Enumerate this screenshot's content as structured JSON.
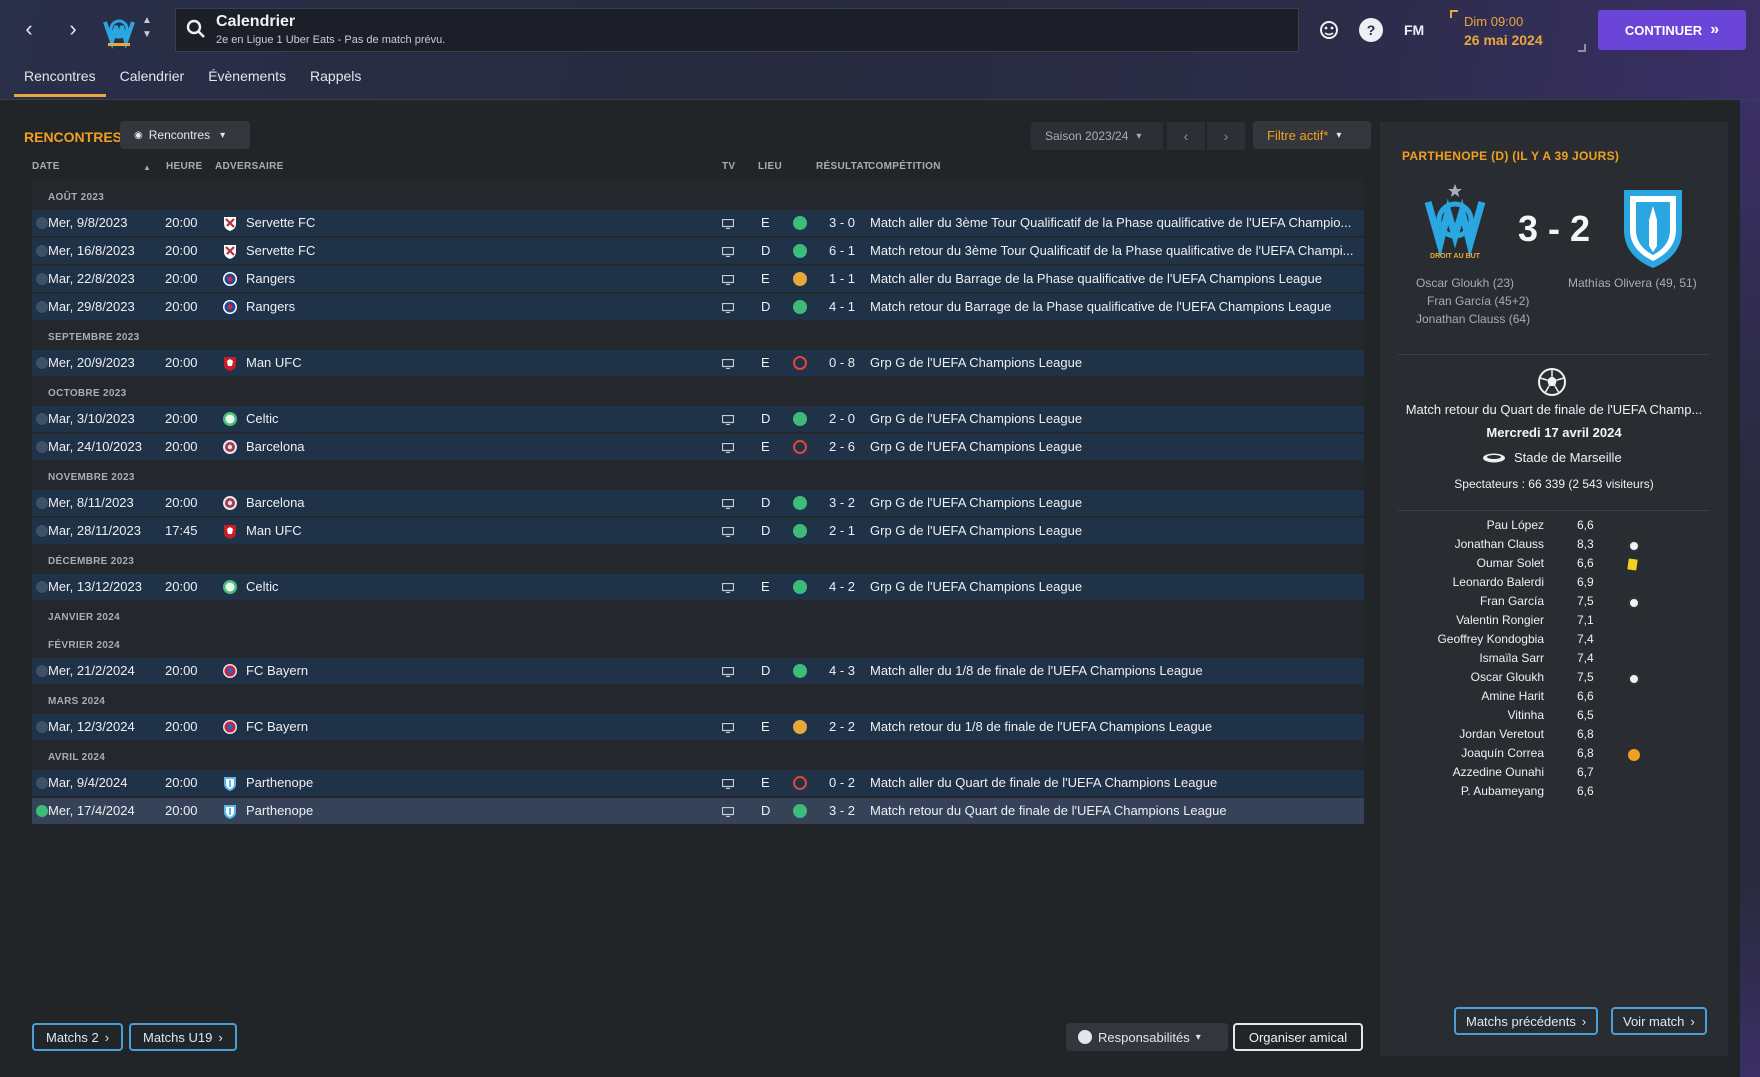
{
  "header": {
    "title": "Calendrier",
    "subtitle": "2e en Ligue 1 Uber Eats - Pas de match prévu.",
    "fm_label": "FM",
    "day_time": "Dim 09:00",
    "date": "26 mai 2024",
    "continue_label": "CONTINUER",
    "club_crest_icon": "om-crest-icon",
    "nav_back_icon": "chevron-left-icon",
    "nav_forward_icon": "chevron-right-icon"
  },
  "tabs": [
    "Rencontres",
    "Calendrier",
    "Évènements",
    "Rappels"
  ],
  "main": {
    "section_title": "RENCONTRES",
    "view_dropdown": "Rencontres",
    "season_dropdown": "Saison 2023/24",
    "filter_label": "Filtre actif*",
    "columns": {
      "date": "DATE",
      "heure": "HEURE",
      "adversaire": "ADVERSAIRE",
      "tv": "TV",
      "lieu": "LIEU",
      "resultat": "RÉSULTAT",
      "competition": "COMPÉTITION"
    },
    "months": [
      "AOÛT 2023",
      "SEPTEMBRE 2023",
      "OCTOBRE 2023",
      "NOVEMBRE 2023",
      "DÉCEMBRE 2023",
      "JANVIER 2024",
      "FÉVRIER 2024",
      "MARS 2024",
      "AVRIL 2024"
    ],
    "matches": [
      {
        "date": "Mer, 9/8/2023",
        "time": "20:00",
        "opponent": "Servette FC",
        "crest": "servette",
        "venue": "E",
        "outcome": "W",
        "score": "3 - 0",
        "competition": "Match aller du 3ème Tour Qualificatif de la Phase qualificative de l'UEFA Champio..."
      },
      {
        "date": "Mer, 16/8/2023",
        "time": "20:00",
        "opponent": "Servette FC",
        "crest": "servette",
        "venue": "D",
        "outcome": "W",
        "score": "6 - 1",
        "competition": "Match retour du 3ème Tour Qualificatif de la Phase qualificative de l'UEFA Champi..."
      },
      {
        "date": "Mar, 22/8/2023",
        "time": "20:00",
        "opponent": "Rangers",
        "crest": "rangers",
        "venue": "E",
        "outcome": "D",
        "score": "1 - 1",
        "competition": "Match aller du Barrage de la Phase qualificative de l'UEFA Champions League"
      },
      {
        "date": "Mar, 29/8/2023",
        "time": "20:00",
        "opponent": "Rangers",
        "crest": "rangers",
        "venue": "D",
        "outcome": "W",
        "score": "4 - 1",
        "competition": "Match retour du Barrage de la Phase qualificative de l'UEFA Champions League"
      },
      {
        "date": "Mer, 20/9/2023",
        "time": "20:00",
        "opponent": "Man UFC",
        "crest": "manufc",
        "venue": "E",
        "outcome": "L",
        "score": "0 - 8",
        "competition": "Grp G de l'UEFA Champions League"
      },
      {
        "date": "Mar, 3/10/2023",
        "time": "20:00",
        "opponent": "Celtic",
        "crest": "celtic",
        "venue": "D",
        "outcome": "W",
        "score": "2 - 0",
        "competition": "Grp G de l'UEFA Champions League"
      },
      {
        "date": "Mar, 24/10/2023",
        "time": "20:00",
        "opponent": "Barcelona",
        "crest": "barcelona",
        "venue": "E",
        "outcome": "L",
        "score": "2 - 6",
        "competition": "Grp G de l'UEFA Champions League"
      },
      {
        "date": "Mer, 8/11/2023",
        "time": "20:00",
        "opponent": "Barcelona",
        "crest": "barcelona",
        "venue": "D",
        "outcome": "W",
        "score": "3 - 2",
        "competition": "Grp G de l'UEFA Champions League"
      },
      {
        "date": "Mar, 28/11/2023",
        "time": "17:45",
        "opponent": "Man UFC",
        "crest": "manufc",
        "venue": "D",
        "outcome": "W",
        "score": "2 - 1",
        "competition": "Grp G de l'UEFA Champions League"
      },
      {
        "date": "Mer, 13/12/2023",
        "time": "20:00",
        "opponent": "Celtic",
        "crest": "celtic",
        "venue": "E",
        "outcome": "W",
        "score": "4 - 2",
        "competition": "Grp G de l'UEFA Champions League"
      },
      {
        "date": "Mer, 21/2/2024",
        "time": "20:00",
        "opponent": "FC Bayern",
        "crest": "bayern",
        "venue": "D",
        "outcome": "W",
        "score": "4 - 3",
        "competition": "Match aller du 1/8 de finale de l'UEFA Champions League"
      },
      {
        "date": "Mar, 12/3/2024",
        "time": "20:00",
        "opponent": "FC Bayern",
        "crest": "bayern",
        "venue": "E",
        "outcome": "D",
        "score": "2 - 2",
        "competition": "Match retour du 1/8 de finale de l'UEFA Champions League"
      },
      {
        "date": "Mar, 9/4/2024",
        "time": "20:00",
        "opponent": "Parthenope",
        "crest": "parthenope",
        "venue": "E",
        "outcome": "L",
        "score": "0 - 2",
        "competition": "Match aller du Quart de finale de l'UEFA Champions League"
      },
      {
        "date": "Mer, 17/4/2024",
        "time": "20:00",
        "opponent": "Parthenope",
        "crest": "parthenope",
        "venue": "D",
        "outcome": "W",
        "score": "3 - 2",
        "competition": "Match retour du Quart de finale de l'UEFA Champions League",
        "selected": true
      }
    ],
    "footer_left": [
      "Matchs 2",
      "Matchs U19"
    ],
    "resp_label": "Responsabilités",
    "amical_label": "Organiser amical"
  },
  "panel": {
    "title": "PARTHENOPE (D) (IL Y A 39 JOURS)",
    "score": "3 - 2",
    "home_crest_motto": "DROIT AU BUT",
    "home_scorers": [
      "Oscar Gloukh (23)",
      "Fran García (45+2)",
      "Jonathan Clauss (64)"
    ],
    "away_scorers": [
      "Mathías Olivera (49, 51)"
    ],
    "competition": "Match retour du Quart de finale de l'UEFA Champ...",
    "date": "Mercredi 17 avril 2024",
    "stadium": "Stade de Marseille",
    "spectators": "Spectateurs : 66 339 (2 543 visiteurs)",
    "players": [
      {
        "name": "Pau López",
        "rating": "6,6",
        "event": ""
      },
      {
        "name": "Jonathan Clauss",
        "rating": "8,3",
        "event": "goal"
      },
      {
        "name": "Oumar Solet",
        "rating": "6,6",
        "event": "yellow"
      },
      {
        "name": "Leonardo Balerdi",
        "rating": "6,9",
        "event": ""
      },
      {
        "name": "Fran García",
        "rating": "7,5",
        "event": "goal"
      },
      {
        "name": "Valentin Rongier",
        "rating": "7,1",
        "event": ""
      },
      {
        "name": "Geoffrey Kondogbia",
        "rating": "7,4",
        "event": ""
      },
      {
        "name": "Ismaïla Sarr",
        "rating": "7,4",
        "event": ""
      },
      {
        "name": "Oscar Gloukh",
        "rating": "7,5",
        "event": "goal"
      },
      {
        "name": "Amine Harit",
        "rating": "6,6",
        "event": ""
      },
      {
        "name": "Vitinha",
        "rating": "6,5",
        "event": ""
      },
      {
        "name": "Jordan Veretout",
        "rating": "6,8",
        "event": ""
      },
      {
        "name": "Joaquín Correa",
        "rating": "6,8",
        "event": "sub"
      },
      {
        "name": "Azzedine Ounahi",
        "rating": "6,7",
        "event": ""
      },
      {
        "name": "P. Aubameyang",
        "rating": "6,6",
        "event": ""
      }
    ],
    "btn_previous": "Matchs précédents",
    "btn_view": "Voir match"
  },
  "colors": {
    "accent_orange": "#f0a020",
    "win": "#3dbb7a",
    "draw": "#e8a93a",
    "loss": "#e0463c",
    "row_bg": "#1f3247",
    "continue_btn": "#6a45d8"
  }
}
